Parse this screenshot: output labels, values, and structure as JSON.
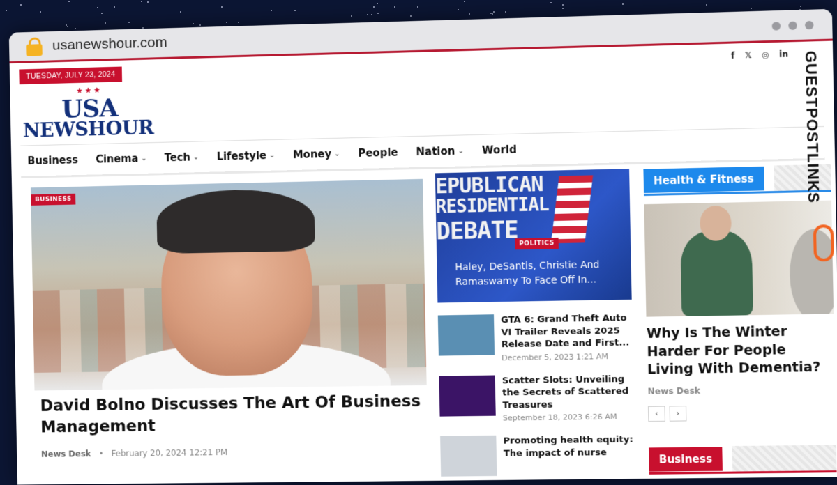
{
  "browser": {
    "url": "usanewshour.com"
  },
  "topbar": {
    "date": "TUESDAY, JULY 23, 2024",
    "social": [
      "f",
      "𝕏",
      "◎",
      "in"
    ]
  },
  "logo": {
    "stars": "★★★",
    "line1": "USA",
    "line2": "NEWSHOUR"
  },
  "nav": [
    {
      "label": "Business",
      "dropdown": false
    },
    {
      "label": "Cinema",
      "dropdown": true
    },
    {
      "label": "Tech",
      "dropdown": true
    },
    {
      "label": "Lifestyle",
      "dropdown": true
    },
    {
      "label": "Money",
      "dropdown": true
    },
    {
      "label": "People",
      "dropdown": false
    },
    {
      "label": "Nation",
      "dropdown": true
    },
    {
      "label": "World",
      "dropdown": false
    }
  ],
  "hero": {
    "tag": "BUSINESS",
    "title": "David Bolno Discusses The Art Of Business Management",
    "author": "News Desk",
    "date": "February 20, 2024 12:21 PM"
  },
  "featured": {
    "image_lines": [
      "EPUBLICAN",
      "RESIDENTIAL",
      "DEBATE"
    ],
    "tag": "POLITICS",
    "title": "Haley, DeSantis, Christie And Ramaswamy To Face Off In..."
  },
  "mini_posts": [
    {
      "title": "GTA 6: Grand Theft Auto VI Trailer Reveals 2025 Release Date and First...",
      "date": "December 5, 2023 1:21 AM",
      "thumb_color": "#5a8fb3"
    },
    {
      "title": "Scatter Slots: Unveiling the Secrets of Scattered Treasures",
      "date": "September 18, 2023 6:26 AM",
      "thumb_color": "#3b1466"
    },
    {
      "title": "Promoting health equity: The impact of nurse",
      "date": "",
      "thumb_color": "#cfd4da"
    }
  ],
  "health": {
    "section": "Health & Fitness",
    "title": "Why Is The Winter Harder For People Living With Dementia?",
    "author": "News Desk",
    "prev": "‹",
    "next": "›"
  },
  "business_section": {
    "label": "Business"
  },
  "watermark": {
    "text": "GUESTPOSTLINKS"
  },
  "colors": {
    "accent_red": "#c8102e",
    "accent_blue": "#1d89ec",
    "logo_navy": "#13307a"
  }
}
